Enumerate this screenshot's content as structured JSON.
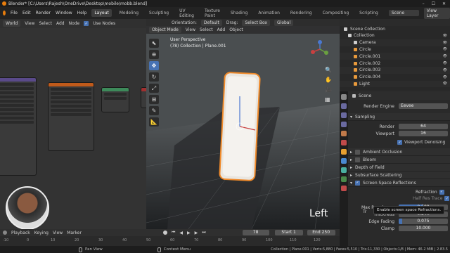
{
  "window": {
    "title": "Blender* [C:\\Users\\Rajesh\\OneDrive\\Desktop\\mobile\\mobb.blend]"
  },
  "menu": {
    "items": [
      "File",
      "Edit",
      "Render",
      "Window",
      "Help"
    ],
    "workspaces": [
      "Layout",
      "Modeling",
      "Sculpting",
      "UV Editing",
      "Texture Paint",
      "Shading",
      "Animation",
      "Rendering",
      "Compositing",
      "Scripting"
    ],
    "scene": "Scene",
    "view_layer": "View Layer"
  },
  "node_editor": {
    "world": "World",
    "menu": [
      "View",
      "Select",
      "Add",
      "Node"
    ],
    "use_nodes": "Use Nodes"
  },
  "viewport_header": {
    "mode": "Object Mode",
    "menu": [
      "View",
      "Select",
      "Add",
      "Object"
    ],
    "orientation_label": "Orientation:",
    "orientation": "Default",
    "drag_label": "Drag:",
    "drag": "Select Box",
    "transform": "Global"
  },
  "viewport": {
    "perspective": "User Perspective",
    "collection_info": "(78) Collection | Plane.001",
    "overlay_text": "Left"
  },
  "outliner": {
    "title": "Scene Collection",
    "items": [
      {
        "name": "Collection",
        "color": "#cfcfcf"
      },
      {
        "name": "Camera",
        "color": "#cfcfcf"
      },
      {
        "name": "Circle",
        "color": "#e89a3c"
      },
      {
        "name": "Circle.001",
        "color": "#e89a3c"
      },
      {
        "name": "Circle.002",
        "color": "#e89a3c"
      },
      {
        "name": "Circle.003",
        "color": "#e89a3c"
      },
      {
        "name": "Circle.004",
        "color": "#e89a3c"
      },
      {
        "name": "Light",
        "color": "#e89a3c"
      }
    ]
  },
  "properties": {
    "scene_label": "Scene",
    "render_engine_label": "Render Engine",
    "render_engine": "Eevee",
    "sampling": "Sampling",
    "render_label": "Render",
    "render_value": "64",
    "viewport_label": "Viewport",
    "viewport_value": "16",
    "viewport_denoising": "Viewport Denoising",
    "panels": [
      "Ambient Occlusion",
      "Bloom",
      "Depth of Field",
      "Subsurface Scattering"
    ],
    "ssr": "Screen Space Reflections",
    "refraction": "Refraction",
    "half_res": "Half Res Trace",
    "trace_prefix": "Tr",
    "tooltip": "Enable screen space Refractions.",
    "fields": [
      {
        "label": "Max Roughness",
        "value": "0.500",
        "fill": 0.5
      },
      {
        "label": "Thickness",
        "value": "0.2 m",
        "fill": 0
      },
      {
        "label": "Edge Fading",
        "value": "0.075",
        "fill": 0.075
      },
      {
        "label": "Clamp",
        "value": "10.000",
        "fill": 0
      }
    ]
  },
  "timeline": {
    "menu": [
      "Playback",
      "Keying",
      "View",
      "Marker"
    ],
    "current_frame": "78",
    "start_label": "Start",
    "start": "1",
    "end_label": "End",
    "end": "250",
    "ticks": [
      "-10",
      "0",
      "10",
      "20",
      "30",
      "40",
      "50",
      "60",
      "70",
      "80",
      "90",
      "100",
      "110",
      "120"
    ]
  },
  "status": {
    "pan_view": "Pan View",
    "context_menu": "Context Menu",
    "stats": "Collection | Plane.001 | Verts:5,880 | Faces:5,510 | Tris:11,330 | Objects:1/8 | Mem: 46.2 MiB | 2.83.5"
  }
}
